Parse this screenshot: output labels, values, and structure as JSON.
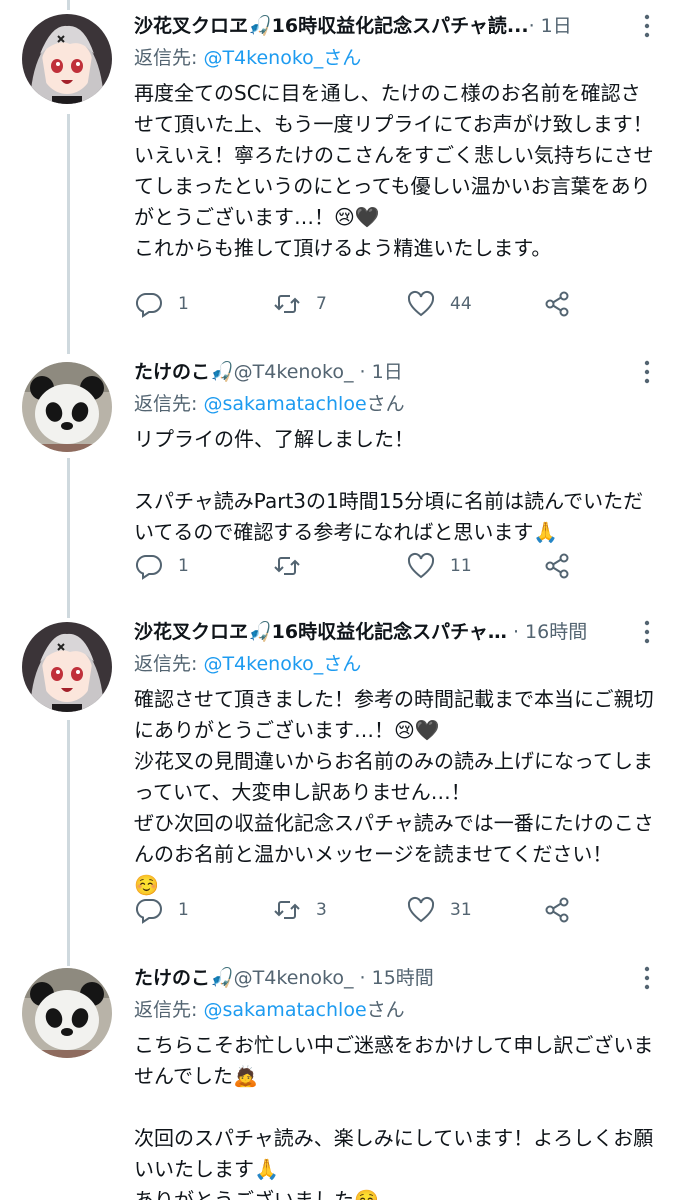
{
  "tweets": [
    {
      "name": "沙花叉クロヱ🎣16時収益化記念スパチャ読...",
      "handle": "",
      "dot": "· ",
      "time": "1日",
      "reply_prefix": "返信先: ",
      "reply_mention": "@T4kenoko_さん",
      "reply_suffix": "",
      "text": "再度全てのSCに目を通し、たけのこ様のお名前を確認させて頂いた上、もう一度リプライにてお声がけ致します！\nいえいえ！寧ろたけのこさんをすごく悲しい気持ちにさせてしまったというのにとっても優しい温かいお言葉をありがとうございます…！😢🖤\nこれからも推して頂けるよう精進いたします。",
      "reply_count": "1",
      "retweet_count": "7",
      "like_count": "44",
      "avatar": "anime-girl-avatar"
    },
    {
      "name": "たけのこ🎣",
      "handle": "@T4kenoko_",
      "dot": " · ",
      "time": "1日",
      "reply_prefix": "返信先: ",
      "reply_mention": "@sakamatachloe",
      "reply_suffix": "さん",
      "text": "リプライの件、了解しました！\n\nスパチャ読みPart3の1時間15分頃に名前は読んでいただいてるので確認する参考になればと思います🙏",
      "reply_count": "1",
      "retweet_count": "",
      "like_count": "11",
      "avatar": "panda-avatar"
    },
    {
      "name": "沙花叉クロヱ🎣16時収益化記念スパチャ…",
      "handle": "",
      "dot": " · ",
      "time": "16時間",
      "reply_prefix": "返信先: ",
      "reply_mention": "@T4kenoko_さん",
      "reply_suffix": "",
      "text": "確認させて頂きました！参考の時間記載まで本当にご親切にありがとうございます…！😢🖤\n沙花叉の見間違いからお名前のみの読み上げになってしまっていて、大変申し訳ありません…！\nぜひ次回の収益化記念スパチャ読みでは一番にたけのこさんのお名前と温かいメッセージを読ませてください！\n☺️",
      "reply_count": "1",
      "retweet_count": "3",
      "like_count": "31",
      "avatar": "anime-girl-avatar"
    },
    {
      "name": "たけのこ🎣",
      "handle": "@T4kenoko_",
      "dot": " · ",
      "time": "15時間",
      "reply_prefix": "返信先: ",
      "reply_mention": "@sakamatachloe",
      "reply_suffix": "さん",
      "text": "こちらこそお忙しい中ご迷惑をおかけして申し訳ございませんでした🙇\n\n次回のスパチャ読み、楽しみにしています！よろしくお願いいたします🙏\nありがとうございました☺️",
      "avatar": "panda-avatar"
    }
  ],
  "colors": {
    "accent": "#1d9bf0",
    "secondary_text": "#536471",
    "thread_line": "#cfd9de"
  },
  "icons": [
    "reply-icon",
    "retweet-icon",
    "like-icon",
    "share-icon",
    "more-icon"
  ]
}
